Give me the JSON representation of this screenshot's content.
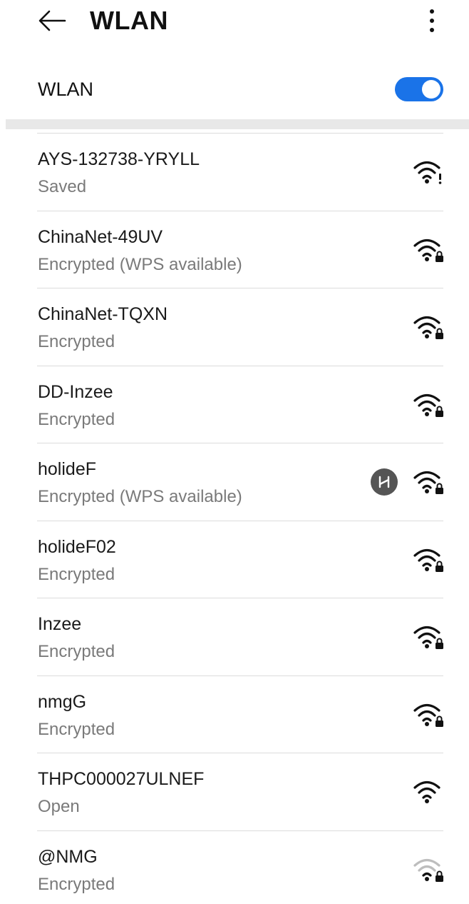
{
  "header": {
    "title": "WLAN",
    "back_icon": "back-arrow-icon",
    "more_icon": "more-vertical-icon"
  },
  "wlan_toggle": {
    "label": "WLAN",
    "on": true,
    "accent_color": "#1a73e8"
  },
  "networks": [
    {
      "name": "AYS-132738-YRYLL",
      "status": "Saved",
      "icon": "wifi-alert-icon",
      "signal": "full"
    },
    {
      "name": "ChinaNet-49UV",
      "status": "Encrypted (WPS available)",
      "icon": "wifi-lock-icon",
      "signal": "full"
    },
    {
      "name": "ChinaNet-TQXN",
      "status": "Encrypted",
      "icon": "wifi-lock-icon",
      "signal": "full"
    },
    {
      "name": "DD-Inzee",
      "status": "Encrypted",
      "icon": "wifi-lock-icon",
      "signal": "full"
    },
    {
      "name": "holideF",
      "status": "Encrypted (WPS available)",
      "icon": "wifi-lock-icon",
      "signal": "full",
      "badge": "hilink-icon"
    },
    {
      "name": "holideF02",
      "status": "Encrypted",
      "icon": "wifi-lock-icon",
      "signal": "full"
    },
    {
      "name": "Inzee",
      "status": "Encrypted",
      "icon": "wifi-lock-icon",
      "signal": "full"
    },
    {
      "name": "nmgG",
      "status": "Encrypted",
      "icon": "wifi-lock-icon",
      "signal": "full"
    },
    {
      "name": "THPC000027ULNEF",
      "status": "Open",
      "icon": "wifi-icon",
      "signal": "full"
    },
    {
      "name": "@NMG",
      "status": "Encrypted",
      "icon": "wifi-lock-icon",
      "signal": "weak"
    }
  ]
}
